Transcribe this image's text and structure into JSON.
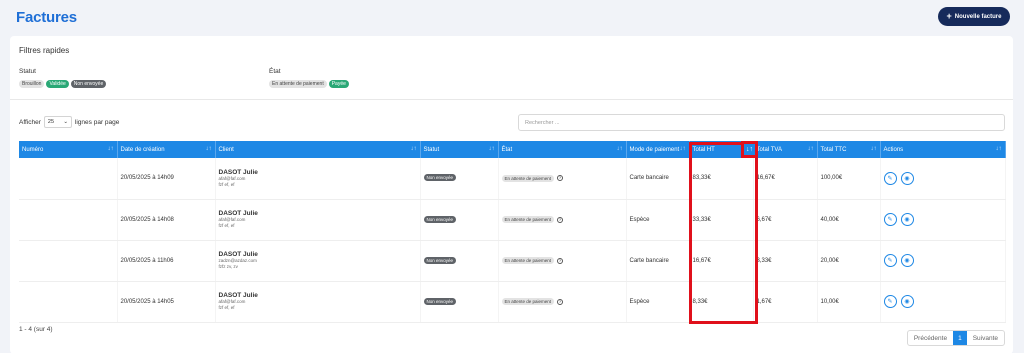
{
  "header": {
    "title": "Factures",
    "new_button": "Nouvelle facture"
  },
  "filters": {
    "title": "Filtres rapides",
    "statut_label": "Statut",
    "statut_chips": [
      "Brouillon",
      "Validée",
      "Non envoyée"
    ],
    "etat_label": "État",
    "etat_chips": [
      "En attente de paiement",
      "Payée"
    ]
  },
  "controls": {
    "show_label": "Afficher",
    "per_page_value": "25",
    "per_page_suffix": "lignes par page",
    "search_placeholder": "Rechercher ..."
  },
  "table": {
    "columns": [
      "Numéro",
      "Date de création",
      "Client",
      "Statut",
      "État",
      "Mode de paiement",
      "Total HT",
      "Total TVA",
      "Total TTC",
      "Actions"
    ],
    "rows": [
      {
        "numero": "",
        "date": "20/05/2025 à 14h09",
        "client_name": "DASOT Julie",
        "client_email": "afaf@faf.com",
        "client_extra": "fzf ef, ef",
        "statut": "Non envoyée",
        "etat": "En attente de paiement",
        "mode": "Carte bancaire",
        "ht": "83,33€",
        "tva": "16,67€",
        "ttc": "100,00€"
      },
      {
        "numero": "",
        "date": "20/05/2025 à 14h08",
        "client_name": "DASOT Julie",
        "client_email": "afaf@faf.com",
        "client_extra": "fzf ef, ef",
        "statut": "Non envoyée",
        "etat": "En attente de paiement",
        "mode": "Espèce",
        "ht": "33,33€",
        "tva": "6,67€",
        "ttc": "40,00€"
      },
      {
        "numero": "",
        "date": "20/05/2025 à 11h06",
        "client_name": "DASOT Julie",
        "client_email": "zadzn@azdaz.com",
        "client_extra": "fzfz zv, zv",
        "statut": "Non envoyée",
        "etat": "En attente de paiement",
        "mode": "Carte bancaire",
        "ht": "16,67€",
        "tva": "3,33€",
        "ttc": "20,00€"
      },
      {
        "numero": "",
        "date": "20/05/2025 à 14h05",
        "client_name": "DASOT Julie",
        "client_email": "afaf@faf.com",
        "client_extra": "fzf ef, ef",
        "statut": "Non envoyée",
        "etat": "En attente de paiement",
        "mode": "Espèce",
        "ht": "8,33€",
        "tva": "1,67€",
        "ttc": "10,00€"
      }
    ]
  },
  "footer": {
    "range": "1 - 4 (sur 4)",
    "prev": "Précédente",
    "current": "1",
    "next": "Suivante"
  },
  "colors": {
    "primary": "#1e88e5",
    "title": "#1f6fd6",
    "button_dark": "#162a5b",
    "highlight": "#e0101b",
    "green": "#2aa876"
  },
  "icons": {
    "sort": "sort-arrows-icon",
    "edit": "pencil-icon",
    "view": "eye-icon",
    "info": "question-circle-icon",
    "select": "chevron-down-icon",
    "add": "plus-icon"
  }
}
